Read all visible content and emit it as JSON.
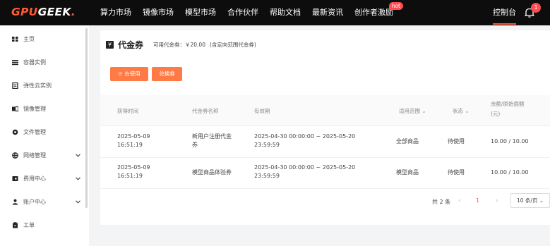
{
  "brand": {
    "gpu": "GPU",
    "geek": "GEEK",
    "dot": "."
  },
  "nav": {
    "items": [
      "算力市场",
      "镜像市场",
      "模型市场",
      "合作伙伴",
      "帮助文档",
      "最新资讯",
      "创作者激励"
    ],
    "hot_badge": "hot",
    "console": "控制台",
    "notification_count": "1"
  },
  "sidebar": {
    "items": [
      {
        "label": "主页",
        "icon": "grid-icon"
      },
      {
        "label": "容器实例",
        "icon": "list-icon"
      },
      {
        "label": "弹性云实例",
        "icon": "document-icon"
      },
      {
        "label": "镜像管理",
        "icon": "image-icon"
      },
      {
        "label": "文件管理",
        "icon": "disk-icon"
      },
      {
        "label": "网络管理",
        "icon": "globe-icon",
        "expandable": true
      },
      {
        "label": "费用中心",
        "icon": "wallet-icon",
        "expandable": true
      },
      {
        "label": "账户中心",
        "icon": "user-icon",
        "expandable": true
      },
      {
        "label": "工单",
        "icon": "ticket-icon"
      }
    ]
  },
  "page": {
    "title": "代金券",
    "balance": "可用代金券：￥20.00",
    "balance_note": "(含定向范围代金券)"
  },
  "buttons": {
    "use": "去使用",
    "redeem": "兑换券"
  },
  "table": {
    "headers": [
      "获得时间",
      "代金券名称",
      "有效期",
      "适用范围",
      "状态",
      "余额/原始面额",
      "(元)"
    ],
    "rows": [
      {
        "time": [
          "2025-05-09",
          "16:51:19"
        ],
        "name": [
          "新用户注册代金",
          "券"
        ],
        "validity": [
          "2025-04-30 00:00:00 ~ 2025-05-20",
          "23:59:59"
        ],
        "scope": "全部商品",
        "status": "待使用",
        "amount": "10.00 / 10.00"
      },
      {
        "time": [
          "2025-05-09",
          "16:51:19"
        ],
        "name": [
          "模型商品体验券"
        ],
        "validity": [
          "2025-04-30 00:00:00 ~ 2025-05-20",
          "23:59:59"
        ],
        "scope": "模型商品",
        "status": "待使用",
        "amount": "10.00 / 10.00"
      }
    ]
  },
  "pagination": {
    "total": "共 2 条",
    "current_page": "1",
    "page_size": "10 条/页"
  },
  "colors": {
    "accent": "#ff5a36",
    "button": "#ff7a45",
    "topbar": "#0d0d0d"
  }
}
